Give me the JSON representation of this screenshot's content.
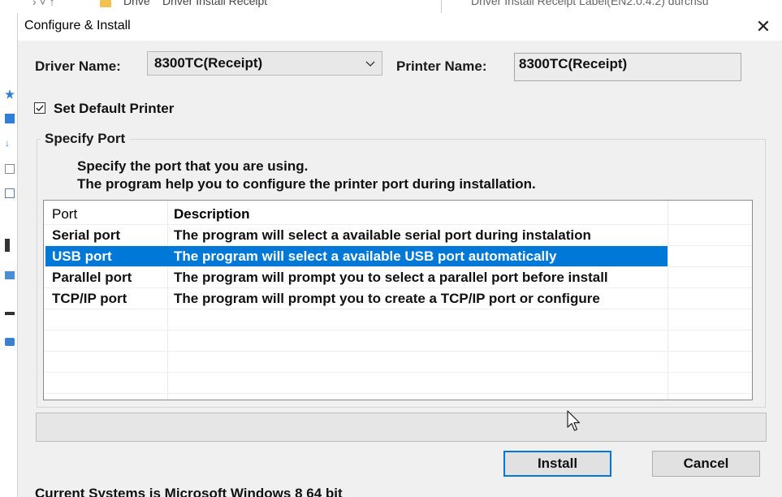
{
  "background": {
    "breadcrumb": [
      "Drive",
      "Driver Install Receipt"
    ],
    "search_text": "Driver Install Receipt Label(EN2.0.4.2) durchsu"
  },
  "window": {
    "title": "Configure & Install",
    "close_glyph": "✕"
  },
  "driver": {
    "label": "Driver Name:",
    "value": "8300TC(Receipt)"
  },
  "printer": {
    "label": "Printer Name:",
    "value": "8300TC(Receipt)"
  },
  "default_printer": {
    "label": "Set Default Printer",
    "checked": true
  },
  "port_group": {
    "legend": "Specify Port",
    "instruction_1": "Specify the port that you are using.",
    "instruction_2": "The program help you to configure the printer port during installation.",
    "columns": [
      "Port",
      "Description"
    ],
    "rows": [
      {
        "port": "Serial port",
        "description": "The program will select a available serial port during instalation",
        "selected": false
      },
      {
        "port": "USB port",
        "description": "The program will select a available USB port automatically",
        "selected": true
      },
      {
        "port": "Parallel port",
        "description": "The program will prompt you to select a parallel port before install",
        "selected": false
      },
      {
        "port": "TCP/IP port",
        "description": "The program will prompt you to create a TCP/IP port or configure",
        "selected": false
      }
    ]
  },
  "buttons": {
    "install": "Install",
    "cancel": "Cancel"
  },
  "status": "Current Systems is Microsoft Windows 8  64 bit",
  "colors": {
    "selection": "#0078d7",
    "dialog_bg": "#f0f0f0",
    "default_button_border": "#0078d7"
  },
  "icons": [
    "close-icon",
    "chevron-down-icon",
    "checkmark-icon",
    "mouse-cursor-icon",
    "folder-icon",
    "star-icon"
  ]
}
